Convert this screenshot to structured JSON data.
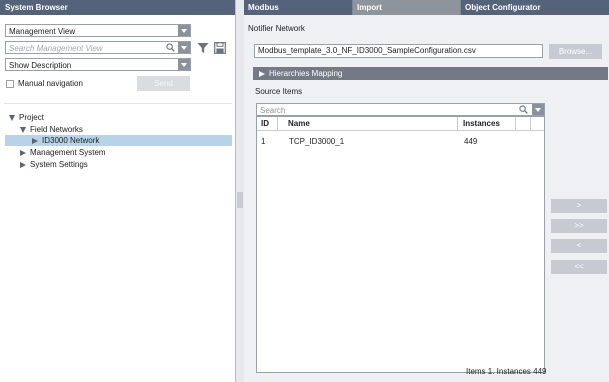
{
  "system_browser": {
    "title": "System Browser",
    "view_select": "Management View",
    "search_placeholder": "Search Management View",
    "description_select": "Show Description",
    "manual_navigation_label": "Manual navigation",
    "send_label": "Send",
    "tree": [
      {
        "label": "Project",
        "expanded": true
      },
      {
        "label": "Field Networks",
        "expanded": true
      },
      {
        "label": "ID3000 Network",
        "expanded": false,
        "selected": true
      },
      {
        "label": "Management System",
        "expanded": false
      },
      {
        "label": "System Settings",
        "expanded": false
      }
    ]
  },
  "tabs": [
    {
      "label": "Modbus",
      "active": false
    },
    {
      "label": "Import",
      "active": true
    },
    {
      "label": "Object Configurator",
      "active": false
    }
  ],
  "import_panel": {
    "section_title": "Notifier Network",
    "file_path": "Modbus_template_3.0_NF_ID3000_SampleConfiguration.csv",
    "browse_label": "Browse...",
    "hierarchies_label": "Hierarchies Mapping",
    "source_items_label": "Source Items",
    "search_placeholder": "Search",
    "columns": [
      "ID",
      "Name",
      "Instances"
    ],
    "rows": [
      {
        "id": "1",
        "name": "TCP_ID3000_1",
        "instances": "449"
      }
    ],
    "status": "Items 1. Instances 449",
    "buttons": [
      ">",
      ">>",
      "<",
      "<<"
    ]
  },
  "colors": {
    "header_bg": "#54637a",
    "active_tab_bg": "#8e949c",
    "selection_bg": "#b8d3e8",
    "panel_bg": "#eef0f3"
  },
  "icons": [
    "search-icon",
    "filter-icon",
    "save-icon",
    "chevron-down-icon",
    "expand-triangle-icon",
    "collapse-triangle-icon"
  ]
}
